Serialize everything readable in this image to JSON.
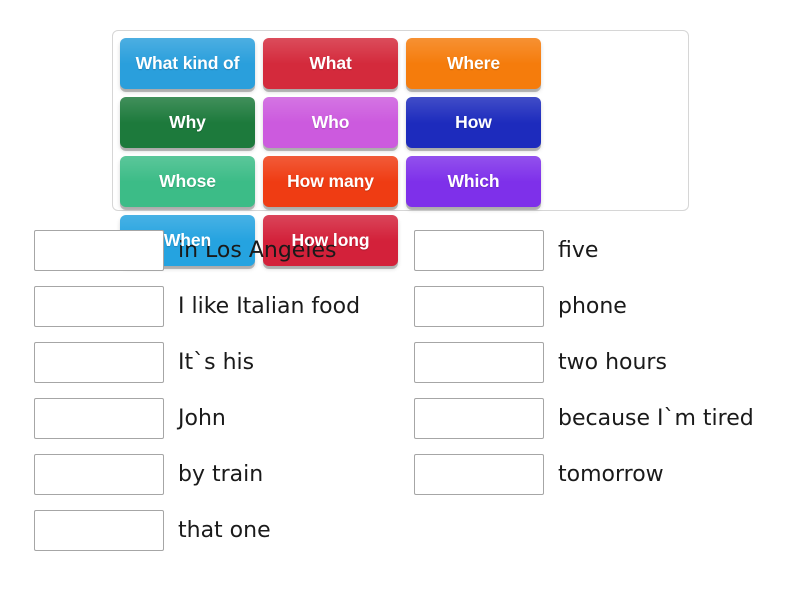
{
  "activity": {
    "type": "match-up",
    "tile_bank": {
      "tiles": [
        {
          "label": "What kind of",
          "color": "#2a9fdc"
        },
        {
          "label": "What",
          "color": "#d42a3c"
        },
        {
          "label": "Where",
          "color": "#f57c0c"
        },
        {
          "label": "Why",
          "color": "#1d7a3c"
        },
        {
          "label": "Who",
          "color": "#cc5ade"
        },
        {
          "label": "How",
          "color": "#1d2bbd"
        },
        {
          "label": "Whose",
          "color": "#3cbc87"
        },
        {
          "label": "How many",
          "color": "#ef3c13"
        },
        {
          "label": "Which",
          "color": "#7e30ea"
        },
        {
          "label": "When",
          "color": "#25a3e0"
        },
        {
          "label": "How long",
          "color": "#d3213a"
        }
      ]
    },
    "answers": {
      "left_column": [
        {
          "slot_value": "",
          "text": "in Los Angeles"
        },
        {
          "slot_value": "",
          "text": "I like Italian food"
        },
        {
          "slot_value": "",
          "text": "It`s his"
        },
        {
          "slot_value": "",
          "text": "John"
        },
        {
          "slot_value": "",
          "text": "by train"
        },
        {
          "slot_value": "",
          "text": "that one"
        }
      ],
      "right_column": [
        {
          "slot_value": "",
          "text": "five"
        },
        {
          "slot_value": "",
          "text": "phone"
        },
        {
          "slot_value": "",
          "text": "two hours"
        },
        {
          "slot_value": "",
          "text": "because I`m tired"
        },
        {
          "slot_value": "",
          "text": "tomorrow"
        }
      ]
    }
  }
}
